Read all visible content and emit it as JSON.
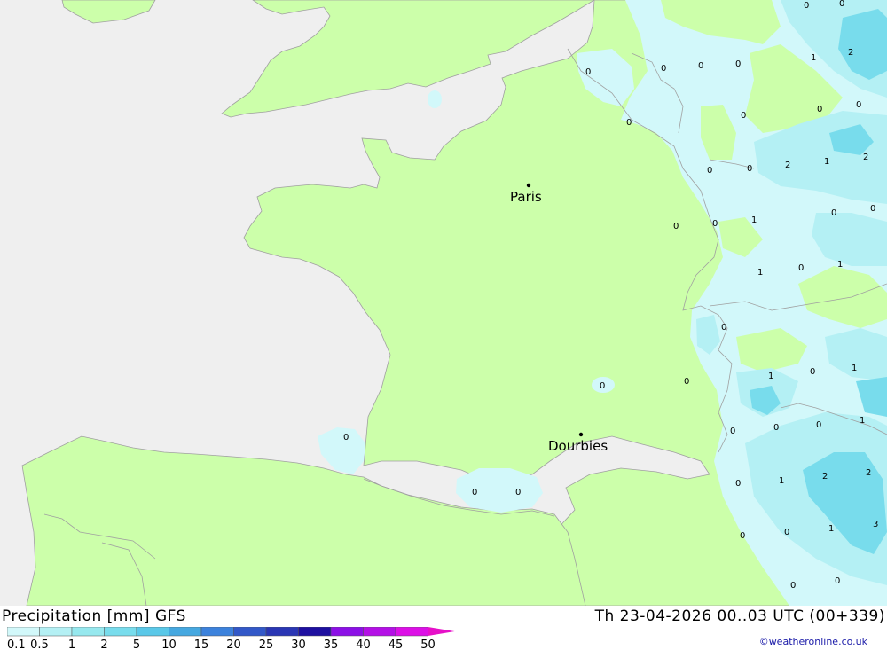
{
  "header": {
    "title": "Precipitation [mm] GFS",
    "datetime": "Th 23-04-2026 00..03 UTC (00+339)",
    "credit": "©weatheronline.co.uk"
  },
  "cities": [
    {
      "name": "Paris"
    },
    {
      "name": "Dourbies"
    }
  ],
  "grid_values": [
    "0",
    "0",
    "1",
    "2",
    "0",
    "0",
    "0",
    "0",
    "0",
    "0",
    "0",
    "0",
    "0",
    "2",
    "1",
    "2",
    "0",
    "0",
    "0",
    "1",
    "0",
    "0",
    "1",
    "0",
    "1",
    "0",
    "0",
    "1",
    "0",
    "1",
    "0",
    "0",
    "0",
    "0",
    "0",
    "1",
    "2",
    "2",
    "0",
    "0",
    "1",
    "3",
    "0",
    "0",
    "1",
    "0",
    "0",
    "0"
  ],
  "legend": {
    "ticks": [
      "0.1",
      "0.5",
      "1",
      "2",
      "5",
      "10",
      "15",
      "20",
      "25",
      "30",
      "35",
      "40",
      "45",
      "50"
    ],
    "colors": [
      "#d2f8fa",
      "#b4f0f4",
      "#96e8ee",
      "#78dcec",
      "#5ac8e8",
      "#46a8e0",
      "#3c82dc",
      "#3258c8",
      "#2a36b4",
      "#1e10a0",
      "#8c10e6",
      "#b410e6",
      "#dc10e6",
      "#e610c8",
      "#c810aa",
      "#aa1496"
    ]
  },
  "colors": {
    "sea": "#efefef",
    "land": "#ccffaa",
    "border": "#a0a0a0",
    "precip_light": "#d2f8fa",
    "precip_mid": "#b4f0f4",
    "precip_heavy": "#78dcec"
  }
}
